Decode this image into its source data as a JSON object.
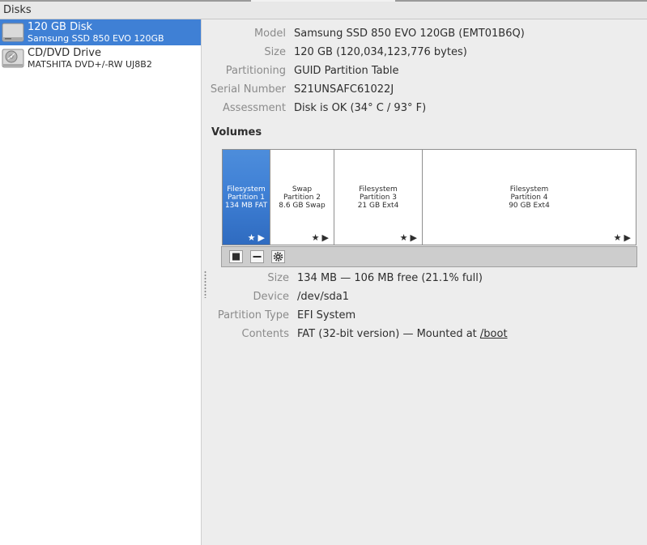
{
  "header": {
    "title": "Disks"
  },
  "sidebar": {
    "items": [
      {
        "name": "120 GB Disk",
        "subtitle": "Samsung SSD 850 EVO 120GB",
        "icon": "hard-disk-icon",
        "selected": true
      },
      {
        "name": "CD/DVD Drive",
        "subtitle": "MATSHITA DVD+/-RW UJ8B2",
        "icon": "optical-drive-icon",
        "selected": false
      }
    ]
  },
  "disk_info": {
    "model_label": "Model",
    "model": "Samsung SSD 850 EVO 120GB (EMT01B6Q)",
    "size_label": "Size",
    "size": "120 GB (120,034,123,776 bytes)",
    "partitioning_label": "Partitioning",
    "partitioning": "GUID Partition Table",
    "serial_label": "Serial Number",
    "serial": "S21UNSAFC61022J",
    "assessment_label": "Assessment",
    "assessment": "Disk is OK (34° C / 93° F)"
  },
  "volumes": {
    "title": "Volumes",
    "partitions": [
      {
        "line1": "Filesystem",
        "line2": "Partition 1",
        "line3": "134 MB FAT",
        "selected": true
      },
      {
        "line1": "Swap",
        "line2": "Partition 2",
        "line3": "8.6 GB Swap",
        "selected": false
      },
      {
        "line1": "Filesystem",
        "line2": "Partition 3",
        "line3": "21 GB Ext4",
        "selected": false
      },
      {
        "line1": "Filesystem",
        "line2": "Partition 4",
        "line3": "90 GB Ext4",
        "selected": false
      }
    ],
    "toolbar": {
      "stop_icon": "stop-icon",
      "remove_icon": "minus-icon",
      "settings_icon": "gear-icon"
    }
  },
  "volume_info": {
    "size_label": "Size",
    "size": "134 MB — 106 MB free (21.1% full)",
    "device_label": "Device",
    "device": "/dev/sda1",
    "ptype_label": "Partition Type",
    "ptype": "EFI System",
    "contents_label": "Contents",
    "contents_prefix": "FAT (32-bit version) — Mounted at ",
    "mount_link": "/boot"
  },
  "colors": {
    "selection": "#3f80d5",
    "label": "#8b8b8b",
    "background": "#ededed"
  }
}
